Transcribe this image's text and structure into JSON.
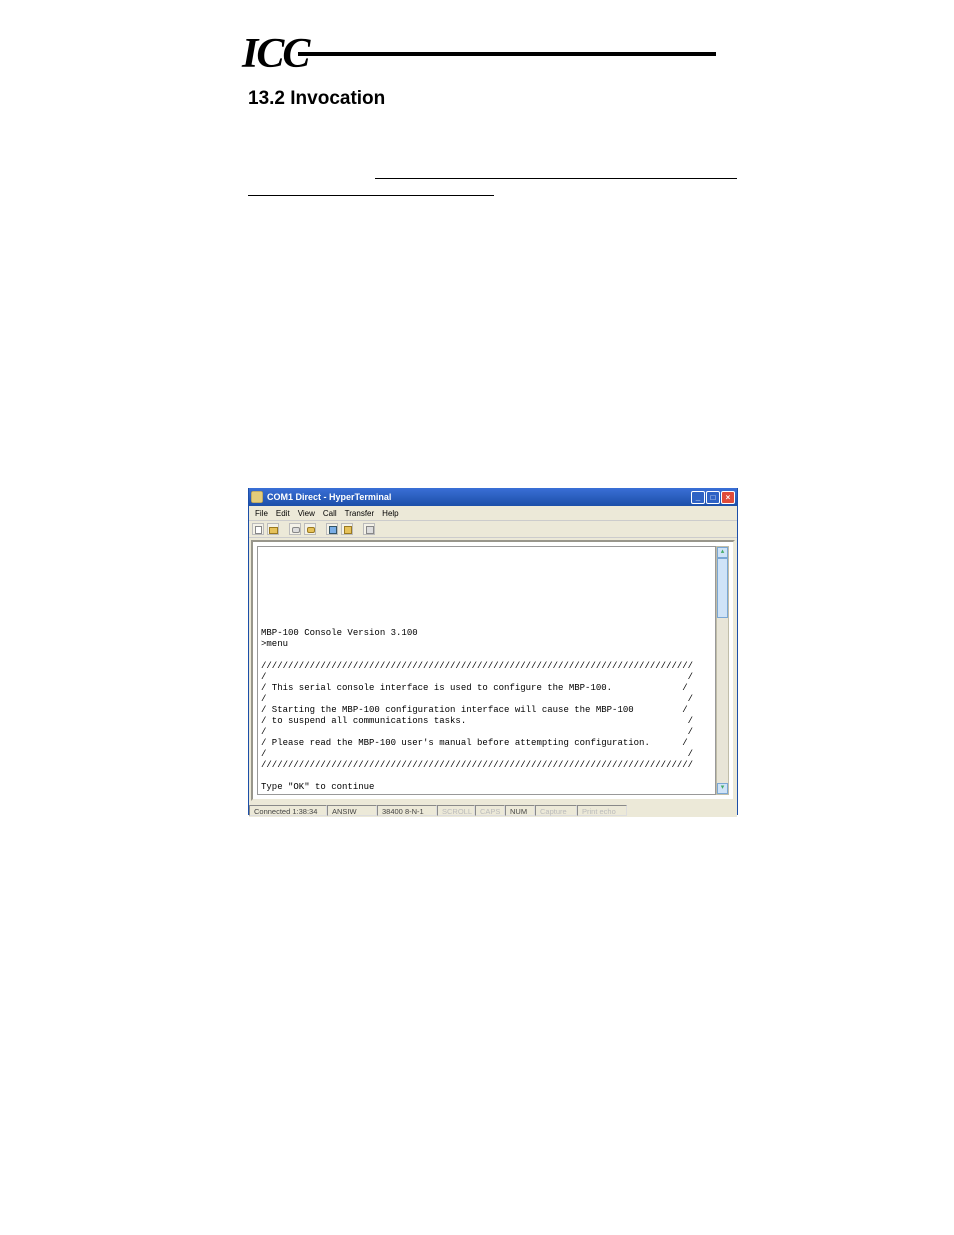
{
  "header": {
    "logo_text": "ICC",
    "section_title": "13.2  Invocation"
  },
  "ht": {
    "title": "COM1 Direct - HyperTerminal",
    "menus": [
      "File",
      "Edit",
      "View",
      "Call",
      "Transfer",
      "Help"
    ],
    "terminal_lines": [
      "",
      "",
      "",
      "",
      "",
      "",
      "",
      "MBP-100 Console Version 3.100",
      ">menu",
      "",
      "////////////////////////////////////////////////////////////////////////////////",
      "/                                                                              /",
      "/ This serial console interface is used to configure the MBP-100.             /",
      "/                                                                              /",
      "/ Starting the MBP-100 configuration interface will cause the MBP-100         /",
      "/ to suspend all communications tasks.                                         /",
      "/                                                                              /",
      "/ Please read the MBP-100 user's manual before attempting configuration.      /",
      "/                                                                              /",
      "////////////////////////////////////////////////////////////////////////////////",
      "",
      "Type \"OK\" to continue",
      "",
      ">"
    ],
    "status": {
      "connected": "Connected 1:38:34",
      "emulation": "ANSIW",
      "port": "38400 8-N-1",
      "scroll": "SCROLL",
      "caps": "CAPS",
      "num": "NUM",
      "capture": "Capture",
      "print": "Print echo"
    }
  }
}
